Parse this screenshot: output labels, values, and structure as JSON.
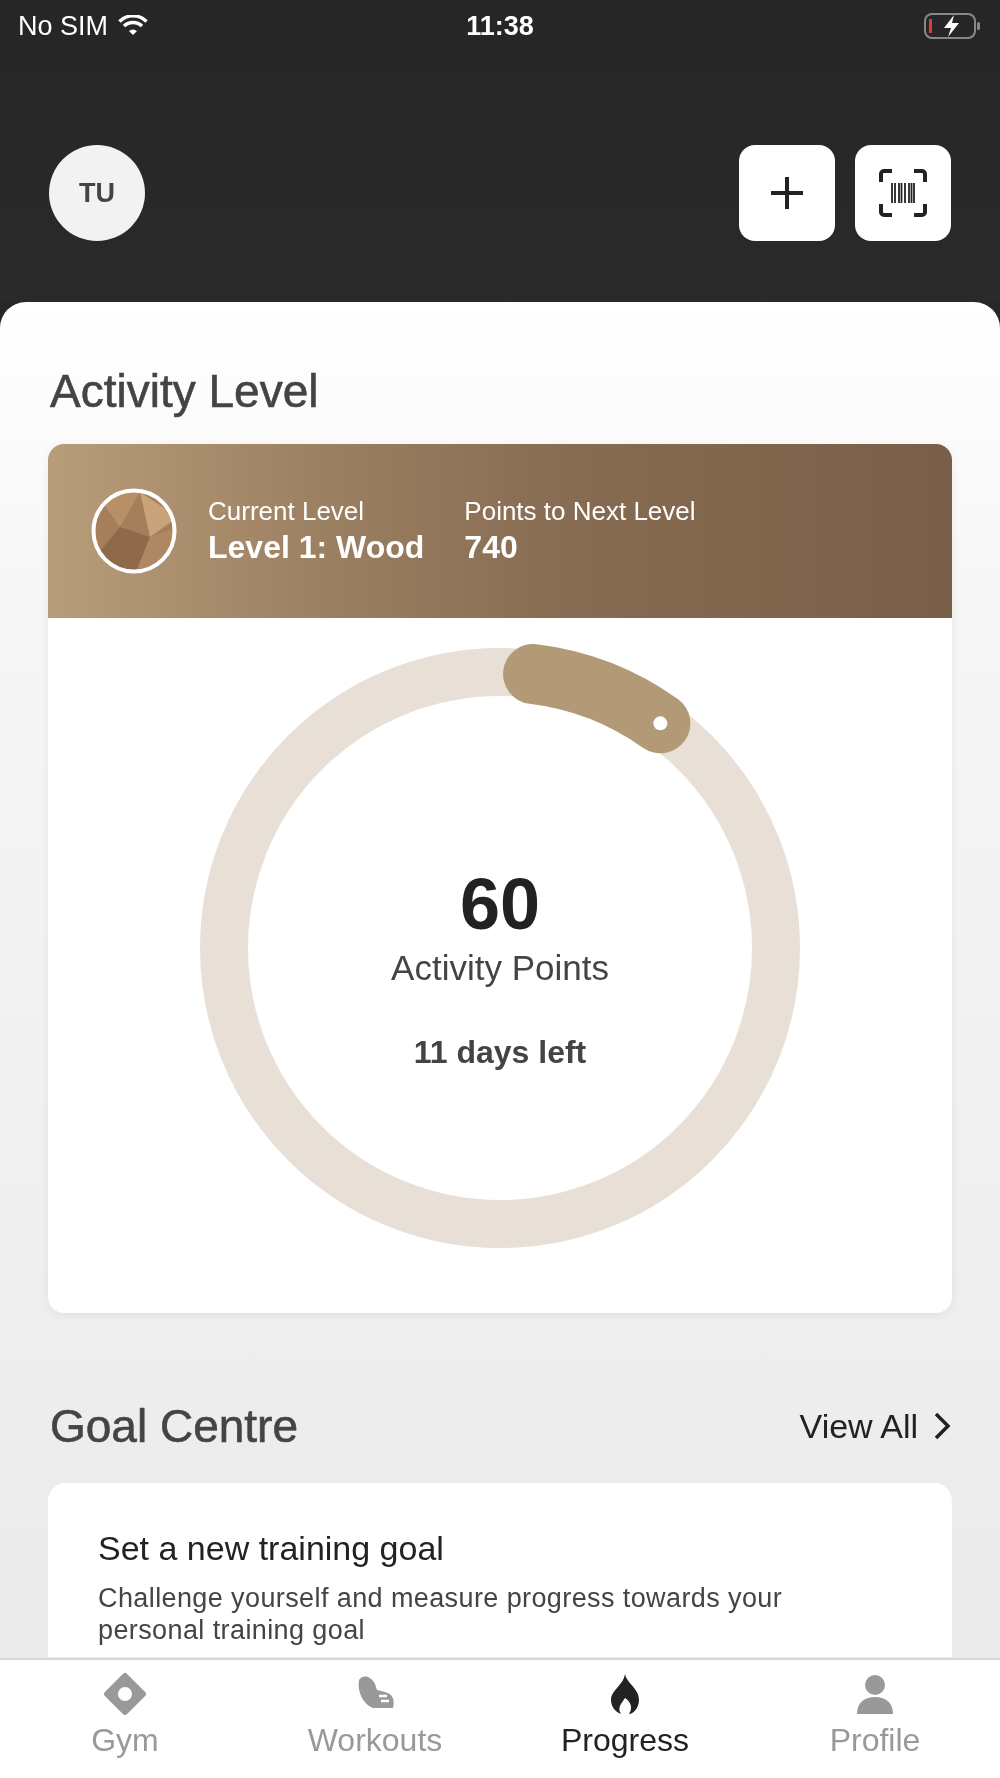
{
  "status_bar": {
    "carrier": "No SIM",
    "time": "11:38"
  },
  "header": {
    "avatar_initials": "TU"
  },
  "activity_level": {
    "title": "Activity Level",
    "current_level_label": "Current Level",
    "current_level": "Level 1: Wood",
    "next_level_label": "Points to Next Level",
    "next_level_points": "740",
    "points": "60",
    "points_label": "Activity Points",
    "days_left": "11 days left"
  },
  "goal_centre": {
    "title": "Goal Centre",
    "view_all": "View All",
    "card_title": "Set a new training goal",
    "card_text": "Challenge yourself and measure progress towards your personal training goal"
  },
  "tabs": [
    {
      "label": "Gym",
      "selected": false
    },
    {
      "label": "Workouts",
      "selected": false
    },
    {
      "label": "Progress",
      "selected": true
    },
    {
      "label": "Profile",
      "selected": false
    }
  ]
}
